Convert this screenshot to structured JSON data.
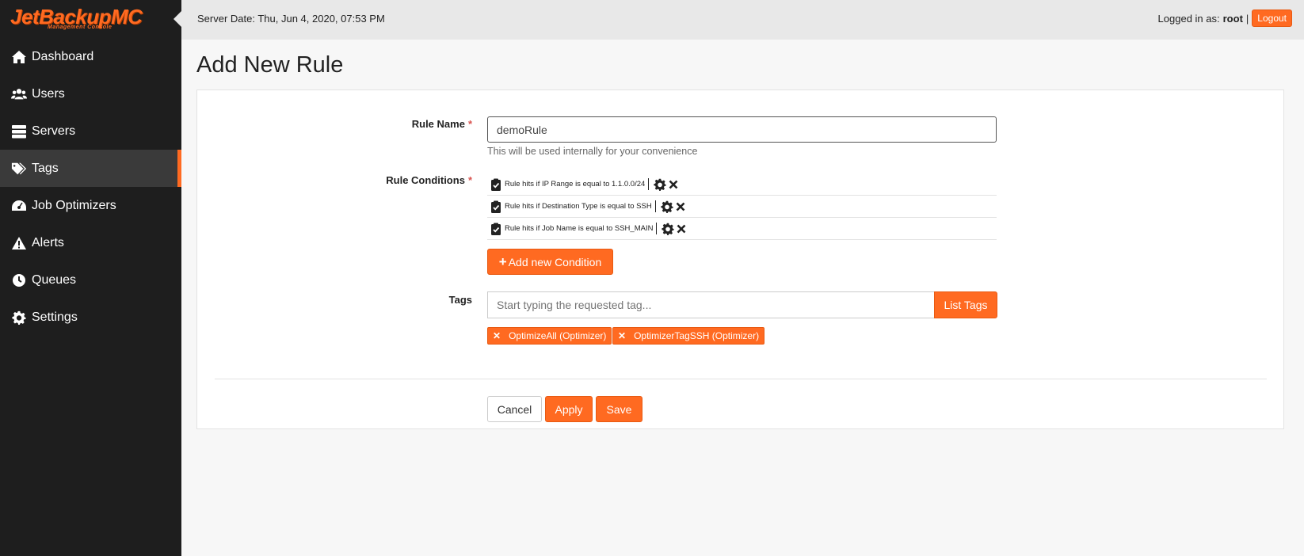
{
  "brand": {
    "name": "JetBackupMC",
    "subtitle": "Management Console"
  },
  "sidebar": {
    "items": [
      {
        "label": "Dashboard",
        "icon": "home-icon",
        "active": false
      },
      {
        "label": "Users",
        "icon": "users-icon",
        "active": false
      },
      {
        "label": "Servers",
        "icon": "servers-icon",
        "active": false
      },
      {
        "label": "Tags",
        "icon": "tags-icon",
        "active": true
      },
      {
        "label": "Job Optimizers",
        "icon": "speedometer-icon",
        "active": false
      },
      {
        "label": "Alerts",
        "icon": "warning-icon",
        "active": false
      },
      {
        "label": "Queues",
        "icon": "clock-icon",
        "active": false
      },
      {
        "label": "Settings",
        "icon": "gear-icon",
        "active": false
      }
    ]
  },
  "topbar": {
    "server_date": "Server Date: Thu, Jun 4, 2020, 07:53 PM",
    "logged_in_label": "Logged in as:",
    "username": "root",
    "separator": "|",
    "logout_label": "Logout"
  },
  "page": {
    "title": "Add New Rule"
  },
  "form": {
    "rule_name": {
      "label": "Rule Name",
      "required_mark": "*",
      "value": "demoRule",
      "help": "This will be used internally for your convenience"
    },
    "rule_conditions": {
      "label": "Rule Conditions",
      "required_mark": "*",
      "items": [
        {
          "text": "Rule hits if IP Range is equal to 1.1.0.0/24"
        },
        {
          "text": "Rule hits if Destination Type is equal to SSH"
        },
        {
          "text": "Rule hits if Job Name is equal to SSH_MAIN"
        }
      ],
      "add_label": "Add new Condition"
    },
    "tags": {
      "label": "Tags",
      "placeholder": "Start typing the requested tag...",
      "list_button": "List Tags",
      "selected": [
        {
          "label": "OptimizeAll (Optimizer)"
        },
        {
          "label": "OptimizerTagSSH (Optimizer)"
        }
      ]
    },
    "actions": {
      "cancel": "Cancel",
      "apply": "Apply",
      "save": "Save"
    }
  },
  "colors": {
    "accent": "#ff6a21",
    "sidebar_bg": "#1e1e1e",
    "topbar_bg": "#e8e8e8",
    "required": "#d9534f"
  }
}
